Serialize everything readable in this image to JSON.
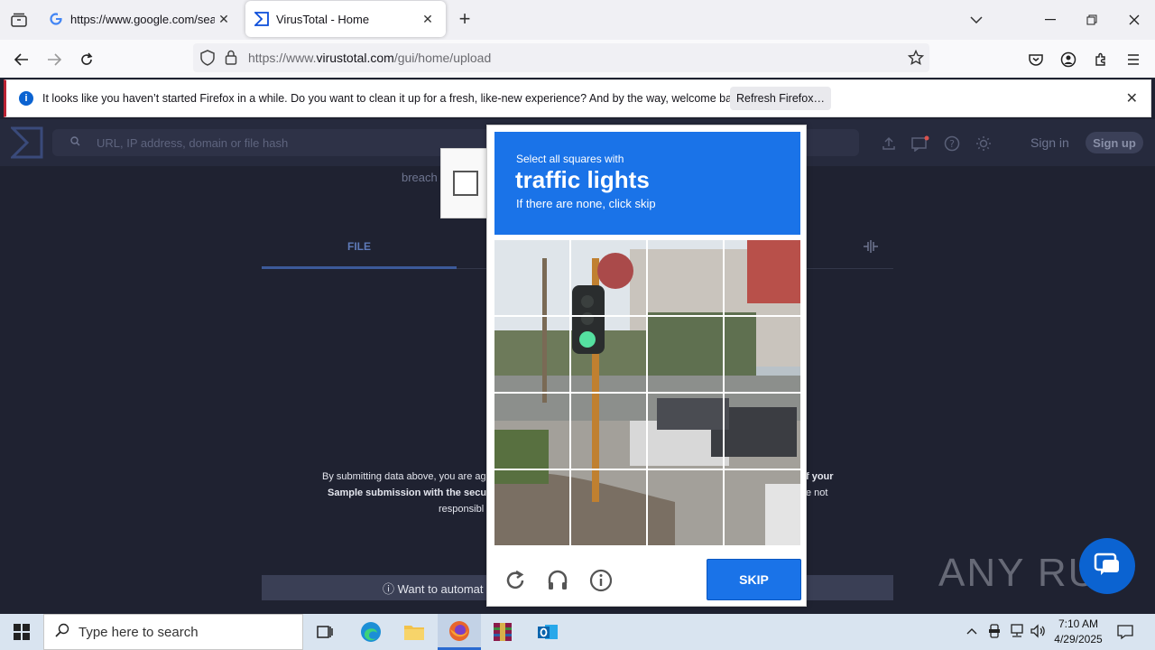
{
  "browser": {
    "tabs": [
      {
        "title": "https://www.google.com/search",
        "active": false
      },
      {
        "title": "VirusTotal - Home",
        "active": true
      }
    ],
    "url_prefix": "https://www.",
    "url_domain": "virustotal.com",
    "url_path": "/gui/home/upload",
    "notification": {
      "message": "It looks like you haven’t started Firefox in a while. Do you want to clean it up for a fresh, like-new experience? And by the way, welcome back!",
      "button": "Refresh Firefox…"
    }
  },
  "page": {
    "search_placeholder": "URL, IP address, domain or file hash",
    "signin": "Sign in",
    "signup": "Sign up",
    "breach_text": "breach",
    "tab_file": "FILE",
    "terms_line1": "By submitting data above, you are ag",
    "terms_line2": "Sample submission with the secur",
    "terms_line3": "responsibl",
    "terms_right1": "f your",
    "terms_right2": "e not",
    "automate": "ⓘ Want to automat"
  },
  "captcha": {
    "instruction": "Select all squares with",
    "target": "traffic lights",
    "hint": "If there are none, click skip",
    "skip": "SKIP"
  },
  "watermark": "ANY RUN",
  "taskbar": {
    "search_placeholder": "Type here to search",
    "time": "7:10 AM",
    "date": "4/29/2025"
  },
  "colors": {
    "accent_blue": "#1a73e8",
    "page_bg": "#1f2231"
  }
}
